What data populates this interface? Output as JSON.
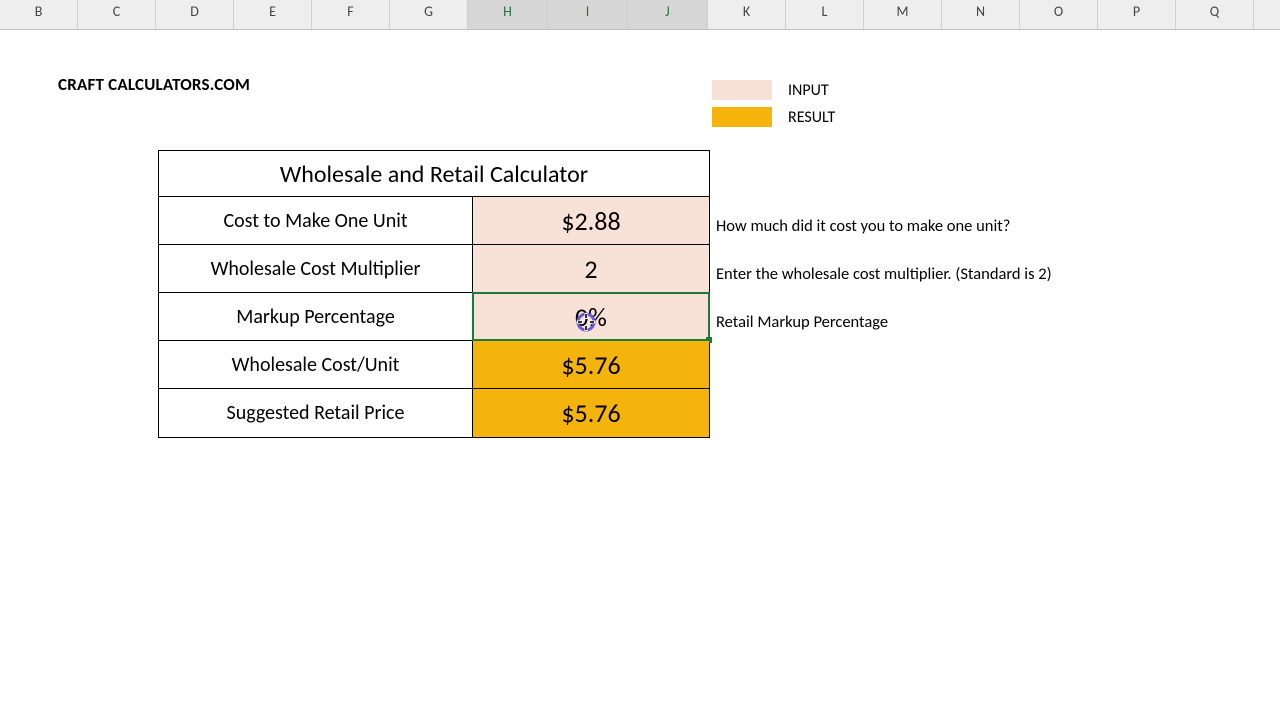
{
  "columns": [
    {
      "letter": "B",
      "width": 78,
      "selected": false
    },
    {
      "letter": "C",
      "width": 78,
      "selected": false
    },
    {
      "letter": "D",
      "width": 78,
      "selected": false
    },
    {
      "letter": "E",
      "width": 78,
      "selected": false
    },
    {
      "letter": "F",
      "width": 78,
      "selected": false
    },
    {
      "letter": "G",
      "width": 78,
      "selected": false
    },
    {
      "letter": "H",
      "width": 80,
      "selected": true
    },
    {
      "letter": "I",
      "width": 80,
      "selected": true
    },
    {
      "letter": "J",
      "width": 80,
      "selected": true
    },
    {
      "letter": "K",
      "width": 78,
      "selected": false
    },
    {
      "letter": "L",
      "width": 78,
      "selected": false
    },
    {
      "letter": "M",
      "width": 78,
      "selected": false
    },
    {
      "letter": "N",
      "width": 78,
      "selected": false
    },
    {
      "letter": "O",
      "width": 78,
      "selected": false
    },
    {
      "letter": "P",
      "width": 78,
      "selected": false
    },
    {
      "letter": "Q",
      "width": 78,
      "selected": false
    }
  ],
  "brand": "CRAFT CALCULATORS.COM",
  "legend": {
    "input": "INPUT",
    "result": "RESULT"
  },
  "calculator": {
    "title": "Wholesale and Retail Calculator",
    "rows": [
      {
        "label": "Cost to Make One Unit",
        "value": "$2.88",
        "kind": "input",
        "hint": "How much did it cost you to make one unit?"
      },
      {
        "label": "Wholesale Cost Multiplier",
        "value": "2",
        "kind": "input",
        "hint": "Enter the wholesale cost multiplier. (Standard is 2)"
      },
      {
        "label": "Markup Percentage",
        "value": "0%",
        "kind": "active",
        "hint": "Retail Markup Percentage"
      },
      {
        "label": "Wholesale Cost/Unit",
        "value": "$5.76",
        "kind": "result",
        "hint": ""
      },
      {
        "label": "Suggested Retail Price",
        "value": "$5.76",
        "kind": "result",
        "hint": ""
      }
    ]
  }
}
